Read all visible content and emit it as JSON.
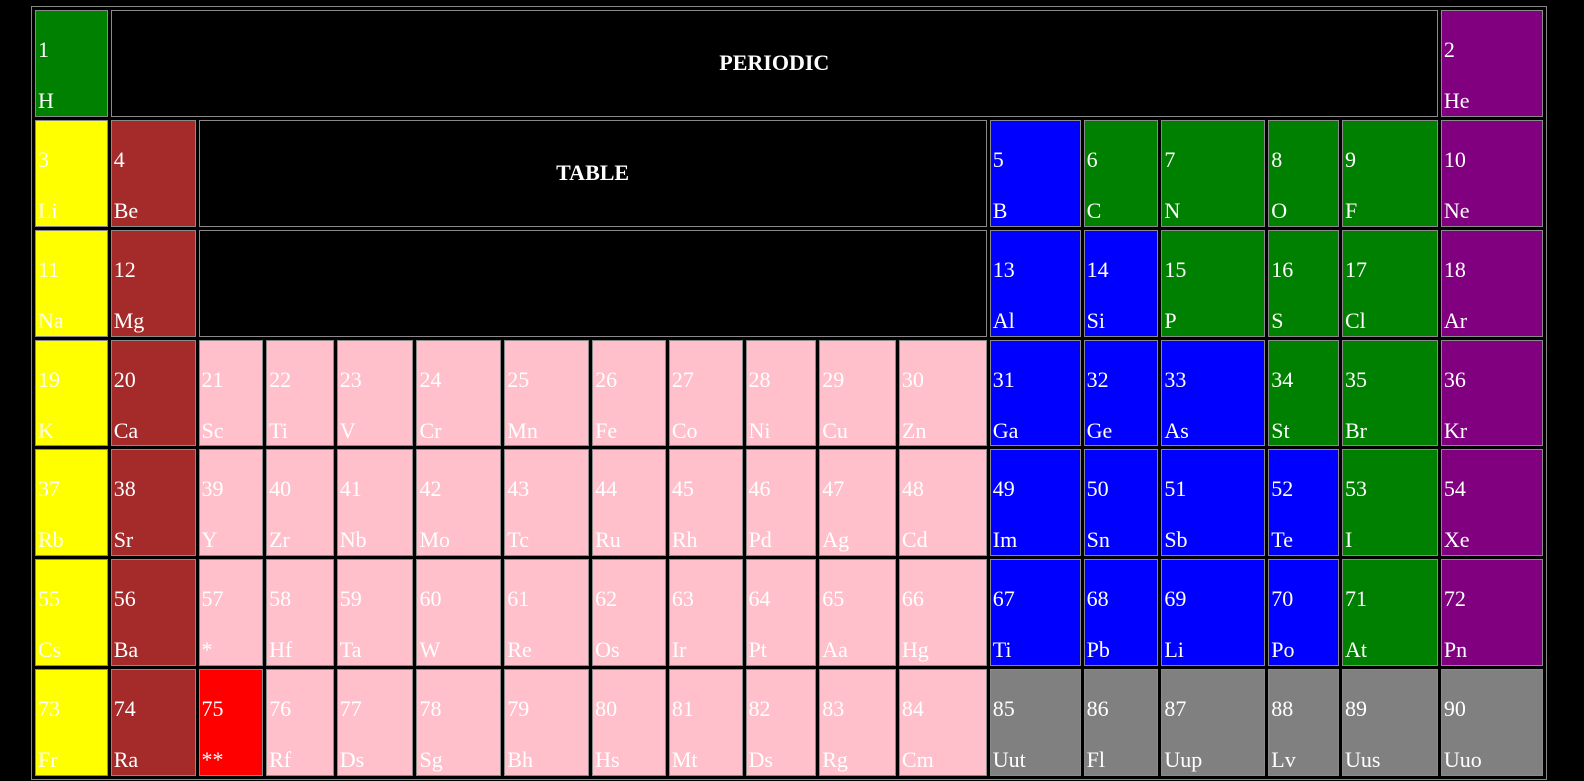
{
  "header": {
    "title_1": "PERIODIC",
    "title_2": "TABLE"
  },
  "colors": {
    "yellow": "#ffff00",
    "brown": "#a52a2a",
    "pink": "#ffc0cb",
    "blue": "#0000ff",
    "green": "#008000",
    "purple": "#800080",
    "gray": "#808080",
    "red": "#ff0000",
    "background": "#000000"
  },
  "rows": [
    [
      {
        "n": "1",
        "s": "H",
        "c": "green"
      },
      {
        "header": "title_1"
      },
      {
        "n": "2",
        "s": "He",
        "c": "purple"
      }
    ],
    [
      {
        "n": "3",
        "s": "Li",
        "c": "yellow"
      },
      {
        "n": "4",
        "s": "Be",
        "c": "brown"
      },
      {
        "header": "title_2"
      },
      {
        "n": "5",
        "s": "B",
        "c": "blue"
      },
      {
        "n": "6",
        "s": "C",
        "c": "green"
      },
      {
        "n": "7",
        "s": "N",
        "c": "green"
      },
      {
        "n": "8",
        "s": "O",
        "c": "green"
      },
      {
        "n": "9",
        "s": "F",
        "c": "green"
      },
      {
        "n": "10",
        "s": "Ne",
        "c": "purple"
      }
    ],
    [
      {
        "n": "11",
        "s": "Na",
        "c": "yellow"
      },
      {
        "n": "12",
        "s": "Mg",
        "c": "brown"
      },
      {
        "empty": true
      },
      {
        "n": "13",
        "s": "Al",
        "c": "blue"
      },
      {
        "n": "14",
        "s": "Si",
        "c": "blue"
      },
      {
        "n": "15",
        "s": "P",
        "c": "green"
      },
      {
        "n": "16",
        "s": "S",
        "c": "green"
      },
      {
        "n": "17",
        "s": "Cl",
        "c": "green"
      },
      {
        "n": "18",
        "s": "Ar",
        "c": "purple"
      }
    ],
    [
      {
        "n": "19",
        "s": "K",
        "c": "yellow"
      },
      {
        "n": "20",
        "s": "Ca",
        "c": "brown"
      },
      {
        "n": "21",
        "s": "Sc",
        "c": "pink"
      },
      {
        "n": "22",
        "s": "Ti",
        "c": "pink"
      },
      {
        "n": "23",
        "s": "V",
        "c": "pink"
      },
      {
        "n": "24",
        "s": "Cr",
        "c": "pink"
      },
      {
        "n": "25",
        "s": "Mn",
        "c": "pink"
      },
      {
        "n": "26",
        "s": "Fe",
        "c": "pink"
      },
      {
        "n": "27",
        "s": "Co",
        "c": "pink"
      },
      {
        "n": "28",
        "s": "Ni",
        "c": "pink"
      },
      {
        "n": "29",
        "s": "Cu",
        "c": "pink"
      },
      {
        "n": "30",
        "s": "Zn",
        "c": "pink"
      },
      {
        "n": "31",
        "s": "Ga",
        "c": "blue"
      },
      {
        "n": "32",
        "s": "Ge",
        "c": "blue"
      },
      {
        "n": "33",
        "s": "As",
        "c": "blue"
      },
      {
        "n": "34",
        "s": "St",
        "c": "green"
      },
      {
        "n": "35",
        "s": "Br",
        "c": "green"
      },
      {
        "n": "36",
        "s": "Kr",
        "c": "purple"
      }
    ],
    [
      {
        "n": "37",
        "s": "Rb",
        "c": "yellow"
      },
      {
        "n": "38",
        "s": "Sr",
        "c": "brown"
      },
      {
        "n": "39",
        "s": "Y",
        "c": "pink"
      },
      {
        "n": "40",
        "s": "Zr",
        "c": "pink"
      },
      {
        "n": "41",
        "s": "Nb",
        "c": "pink"
      },
      {
        "n": "42",
        "s": "Mo",
        "c": "pink"
      },
      {
        "n": "43",
        "s": "Tc",
        "c": "pink"
      },
      {
        "n": "44",
        "s": "Ru",
        "c": "pink"
      },
      {
        "n": "45",
        "s": "Rh",
        "c": "pink"
      },
      {
        "n": "46",
        "s": "Pd",
        "c": "pink"
      },
      {
        "n": "47",
        "s": "Ag",
        "c": "pink"
      },
      {
        "n": "48",
        "s": "Cd",
        "c": "pink"
      },
      {
        "n": "49",
        "s": "Im",
        "c": "blue"
      },
      {
        "n": "50",
        "s": "Sn",
        "c": "blue"
      },
      {
        "n": "51",
        "s": "Sb",
        "c": "blue"
      },
      {
        "n": "52",
        "s": "Te",
        "c": "blue"
      },
      {
        "n": "53",
        "s": "I",
        "c": "green"
      },
      {
        "n": "54",
        "s": "Xe",
        "c": "purple"
      }
    ],
    [
      {
        "n": "55",
        "s": "Cs",
        "c": "yellow"
      },
      {
        "n": "56",
        "s": "Ba",
        "c": "brown"
      },
      {
        "n": "57",
        "s": "*",
        "c": "pink"
      },
      {
        "n": "58",
        "s": "Hf",
        "c": "pink"
      },
      {
        "n": "59",
        "s": "Ta",
        "c": "pink"
      },
      {
        "n": "60",
        "s": "W",
        "c": "pink"
      },
      {
        "n": "61",
        "s": "Re",
        "c": "pink"
      },
      {
        "n": "62",
        "s": "Os",
        "c": "pink"
      },
      {
        "n": "63",
        "s": "Ir",
        "c": "pink"
      },
      {
        "n": "64",
        "s": "Pt",
        "c": "pink"
      },
      {
        "n": "65",
        "s": "Aa",
        "c": "pink"
      },
      {
        "n": "66",
        "s": "Hg",
        "c": "pink"
      },
      {
        "n": "67",
        "s": "Ti",
        "c": "blue"
      },
      {
        "n": "68",
        "s": "Pb",
        "c": "blue"
      },
      {
        "n": "69",
        "s": "Li",
        "c": "blue"
      },
      {
        "n": "70",
        "s": "Po",
        "c": "blue"
      },
      {
        "n": "71",
        "s": "At",
        "c": "green"
      },
      {
        "n": "72",
        "s": "Pn",
        "c": "purple"
      }
    ],
    [
      {
        "n": "73",
        "s": "Fr",
        "c": "yellow"
      },
      {
        "n": "74",
        "s": "Ra",
        "c": "brown"
      },
      {
        "n": "75",
        "s": "**",
        "c": "red"
      },
      {
        "n": "76",
        "s": "Rf",
        "c": "pink"
      },
      {
        "n": "77",
        "s": "Ds",
        "c": "pink"
      },
      {
        "n": "78",
        "s": "Sg",
        "c": "pink"
      },
      {
        "n": "79",
        "s": "Bh",
        "c": "pink"
      },
      {
        "n": "80",
        "s": "Hs",
        "c": "pink"
      },
      {
        "n": "81",
        "s": "Mt",
        "c": "pink"
      },
      {
        "n": "82",
        "s": "Ds",
        "c": "pink"
      },
      {
        "n": "83",
        "s": "Rg",
        "c": "pink"
      },
      {
        "n": "84",
        "s": "Cm",
        "c": "pink"
      },
      {
        "n": "85",
        "s": "Uut",
        "c": "gray"
      },
      {
        "n": "86",
        "s": "Fl",
        "c": "gray"
      },
      {
        "n": "87",
        "s": "Uup",
        "c": "gray"
      },
      {
        "n": "88",
        "s": "Lv",
        "c": "gray"
      },
      {
        "n": "89",
        "s": "Uus",
        "c": "gray"
      },
      {
        "n": "90",
        "s": "Uuo",
        "c": "gray"
      }
    ]
  ]
}
